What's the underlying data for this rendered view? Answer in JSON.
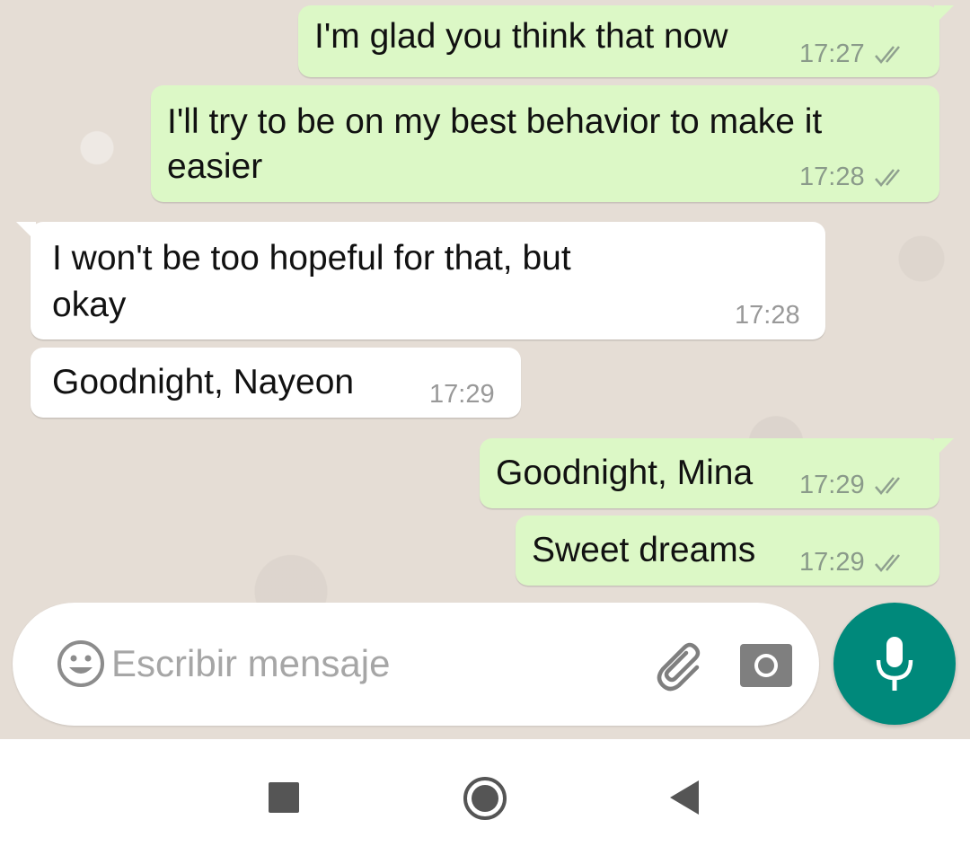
{
  "messages": [
    {
      "direction": "out",
      "text_lines": [
        "I'm glad you think that now"
      ],
      "time": "17:27",
      "ticks": "read"
    },
    {
      "direction": "out",
      "text_lines": [
        "I'll try to be on my best behavior to make it",
        "easier"
      ],
      "time": "17:28",
      "ticks": "read"
    },
    {
      "direction": "in",
      "text_lines": [
        "I won't be too hopeful for that, but",
        "okay"
      ],
      "time": "17:28"
    },
    {
      "direction": "in",
      "text_lines": [
        "Goodnight, Nayeon"
      ],
      "time": "17:29"
    },
    {
      "direction": "out",
      "text_lines": [
        "Goodnight, Mina"
      ],
      "time": "17:29",
      "ticks": "read"
    },
    {
      "direction": "out",
      "text_lines": [
        "Sweet dreams"
      ],
      "time": "17:29",
      "ticks": "read"
    }
  ],
  "composer": {
    "placeholder": "Escribir mensaje",
    "icons": [
      "emoji-icon",
      "attach-icon",
      "camera-icon"
    ]
  },
  "mic_button": {
    "icon": "microphone-icon",
    "color": "#00897b"
  },
  "nav_bar": {
    "icons": [
      "recents-icon",
      "home-icon",
      "back-icon"
    ]
  },
  "colors": {
    "outgoing_bubble": "#dcf8c6",
    "incoming_bubble": "#ffffff",
    "chat_background": "#e5ddd5"
  }
}
